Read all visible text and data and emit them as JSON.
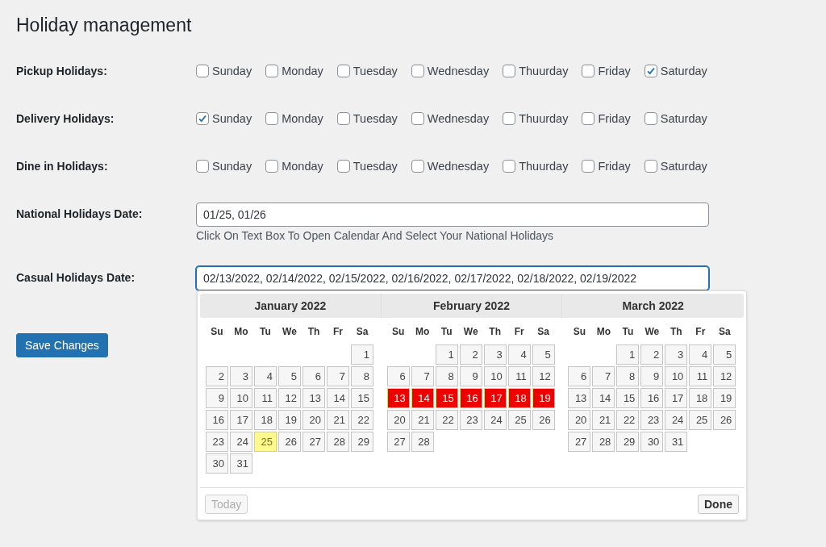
{
  "title": "Holiday management",
  "day_groups": [
    {
      "label": "Pickup Holidays:",
      "options": [
        {
          "label": "Sunday",
          "checked": false
        },
        {
          "label": "Monday",
          "checked": false
        },
        {
          "label": "Tuesday",
          "checked": false
        },
        {
          "label": "Wednesday",
          "checked": false
        },
        {
          "label": "Thuurday",
          "checked": false
        },
        {
          "label": "Friday",
          "checked": false
        },
        {
          "label": "Saturday",
          "checked": true
        }
      ]
    },
    {
      "label": "Delivery Holidays:",
      "options": [
        {
          "label": "Sunday",
          "checked": true
        },
        {
          "label": "Monday",
          "checked": false
        },
        {
          "label": "Tuesday",
          "checked": false
        },
        {
          "label": "Wednesday",
          "checked": false
        },
        {
          "label": "Thuurday",
          "checked": false
        },
        {
          "label": "Friday",
          "checked": false
        },
        {
          "label": "Saturday",
          "checked": false
        }
      ]
    },
    {
      "label": "Dine in Holidays:",
      "options": [
        {
          "label": "Sunday",
          "checked": false
        },
        {
          "label": "Monday",
          "checked": false
        },
        {
          "label": "Tuesday",
          "checked": false
        },
        {
          "label": "Wednesday",
          "checked": false
        },
        {
          "label": "Thuurday",
          "checked": false
        },
        {
          "label": "Friday",
          "checked": false
        },
        {
          "label": "Saturday",
          "checked": false
        }
      ]
    }
  ],
  "date_fields": [
    {
      "label": "National Holidays Date:",
      "value": "01/25, 01/26",
      "focused": false,
      "help": "Click On Text Box To Open Calendar And Select Your National Holidays"
    },
    {
      "label": "Casual Holidays Date:",
      "value": "02/13/2022, 02/14/2022, 02/15/2022, 02/16/2022, 02/17/2022, 02/18/2022, 02/19/2022",
      "focused": true
    }
  ],
  "save_button": "Save Changes",
  "calendar": {
    "months": [
      {
        "title": "January 2022",
        "weekdays": [
          "Su",
          "Mo",
          "Tu",
          "We",
          "Th",
          "Fr",
          "Sa"
        ],
        "weeks": [
          [
            {
              "day": "1",
              "selected": false,
              "today": false
            }
          ],
          [
            {
              "day": "2",
              "selected": false,
              "today": false
            },
            {
              "day": "3",
              "selected": false,
              "today": false
            },
            {
              "day": "4",
              "selected": false,
              "today": false
            },
            {
              "day": "5",
              "selected": false,
              "today": false
            },
            {
              "day": "6",
              "selected": false,
              "today": false
            },
            {
              "day": "7",
              "selected": false,
              "today": false
            },
            {
              "day": "8",
              "selected": false,
              "today": false
            }
          ],
          [
            {
              "day": "9",
              "selected": false,
              "today": false
            },
            {
              "day": "10",
              "selected": false,
              "today": false
            },
            {
              "day": "11",
              "selected": false,
              "today": false
            },
            {
              "day": "12",
              "selected": false,
              "today": false
            },
            {
              "day": "13",
              "selected": false,
              "today": false
            },
            {
              "day": "14",
              "selected": false,
              "today": false
            },
            {
              "day": "15",
              "selected": false,
              "today": false
            }
          ],
          [
            {
              "day": "16",
              "selected": false,
              "today": false
            },
            {
              "day": "17",
              "selected": false,
              "today": false
            },
            {
              "day": "18",
              "selected": false,
              "today": false
            },
            {
              "day": "19",
              "selected": false,
              "today": false
            },
            {
              "day": "20",
              "selected": false,
              "today": false
            },
            {
              "day": "21",
              "selected": false,
              "today": false
            },
            {
              "day": "22",
              "selected": false,
              "today": false
            }
          ],
          [
            {
              "day": "23",
              "selected": false,
              "today": false
            },
            {
              "day": "24",
              "selected": false,
              "today": false
            },
            {
              "day": "25",
              "selected": false,
              "today": true
            },
            {
              "day": "26",
              "selected": false,
              "today": false
            },
            {
              "day": "27",
              "selected": false,
              "today": false
            },
            {
              "day": "28",
              "selected": false,
              "today": false
            },
            {
              "day": "29",
              "selected": false,
              "today": false
            }
          ],
          [
            {
              "day": "30",
              "selected": false,
              "today": false
            },
            {
              "day": "31",
              "selected": false,
              "today": false
            }
          ]
        ]
      },
      {
        "title": "February 2022",
        "weekdays": [
          "Su",
          "Mo",
          "Tu",
          "We",
          "Th",
          "Fr",
          "Sa"
        ],
        "weeks": [
          [
            {
              "day": "1",
              "selected": false,
              "today": false
            },
            {
              "day": "2",
              "selected": false,
              "today": false
            },
            {
              "day": "3",
              "selected": false,
              "today": false
            },
            {
              "day": "4",
              "selected": false,
              "today": false
            },
            {
              "day": "5",
              "selected": false,
              "today": false
            }
          ],
          [
            {
              "day": "6",
              "selected": false,
              "today": false
            },
            {
              "day": "7",
              "selected": false,
              "today": false
            },
            {
              "day": "8",
              "selected": false,
              "today": false
            },
            {
              "day": "9",
              "selected": false,
              "today": false
            },
            {
              "day": "10",
              "selected": false,
              "today": false
            },
            {
              "day": "11",
              "selected": false,
              "today": false
            },
            {
              "day": "12",
              "selected": false,
              "today": false
            }
          ],
          [
            {
              "day": "13",
              "selected": true,
              "today": false
            },
            {
              "day": "14",
              "selected": true,
              "today": false
            },
            {
              "day": "15",
              "selected": true,
              "today": false
            },
            {
              "day": "16",
              "selected": true,
              "today": false
            },
            {
              "day": "17",
              "selected": true,
              "today": false
            },
            {
              "day": "18",
              "selected": true,
              "today": false
            },
            {
              "day": "19",
              "selected": true,
              "today": false
            }
          ],
          [
            {
              "day": "20",
              "selected": false,
              "today": false
            },
            {
              "day": "21",
              "selected": false,
              "today": false
            },
            {
              "day": "22",
              "selected": false,
              "today": false
            },
            {
              "day": "23",
              "selected": false,
              "today": false
            },
            {
              "day": "24",
              "selected": false,
              "today": false
            },
            {
              "day": "25",
              "selected": false,
              "today": false
            },
            {
              "day": "26",
              "selected": false,
              "today": false
            }
          ],
          [
            {
              "day": "27",
              "selected": false,
              "today": false
            },
            {
              "day": "28",
              "selected": false,
              "today": false
            }
          ]
        ]
      },
      {
        "title": "March 2022",
        "weekdays": [
          "Su",
          "Mo",
          "Tu",
          "We",
          "Th",
          "Fr",
          "Sa"
        ],
        "weeks": [
          [
            {
              "day": "1",
              "selected": false,
              "today": false
            },
            {
              "day": "2",
              "selected": false,
              "today": false
            },
            {
              "day": "3",
              "selected": false,
              "today": false
            },
            {
              "day": "4",
              "selected": false,
              "today": false
            },
            {
              "day": "5",
              "selected": false,
              "today": false
            }
          ],
          [
            {
              "day": "6",
              "selected": false,
              "today": false
            },
            {
              "day": "7",
              "selected": false,
              "today": false
            },
            {
              "day": "8",
              "selected": false,
              "today": false
            },
            {
              "day": "9",
              "selected": false,
              "today": false
            },
            {
              "day": "10",
              "selected": false,
              "today": false
            },
            {
              "day": "11",
              "selected": false,
              "today": false
            },
            {
              "day": "12",
              "selected": false,
              "today": false
            }
          ],
          [
            {
              "day": "13",
              "selected": false,
              "today": false
            },
            {
              "day": "14",
              "selected": false,
              "today": false
            },
            {
              "day": "15",
              "selected": false,
              "today": false
            },
            {
              "day": "16",
              "selected": false,
              "today": false
            },
            {
              "day": "17",
              "selected": false,
              "today": false
            },
            {
              "day": "18",
              "selected": false,
              "today": false
            },
            {
              "day": "19",
              "selected": false,
              "today": false
            }
          ],
          [
            {
              "day": "20",
              "selected": false,
              "today": false
            },
            {
              "day": "21",
              "selected": false,
              "today": false
            },
            {
              "day": "22",
              "selected": false,
              "today": false
            },
            {
              "day": "23",
              "selected": false,
              "today": false
            },
            {
              "day": "24",
              "selected": false,
              "today": false
            },
            {
              "day": "25",
              "selected": false,
              "today": false
            },
            {
              "day": "26",
              "selected": false,
              "today": false
            }
          ],
          [
            {
              "day": "27",
              "selected": false,
              "today": false
            },
            {
              "day": "28",
              "selected": false,
              "today": false
            },
            {
              "day": "29",
              "selected": false,
              "today": false
            },
            {
              "day": "30",
              "selected": false,
              "today": false
            },
            {
              "day": "31",
              "selected": false,
              "today": false
            }
          ]
        ]
      }
    ],
    "today_button": {
      "label": "Today",
      "disabled": true
    },
    "done_button": {
      "label": "Done",
      "disabled": false
    }
  }
}
